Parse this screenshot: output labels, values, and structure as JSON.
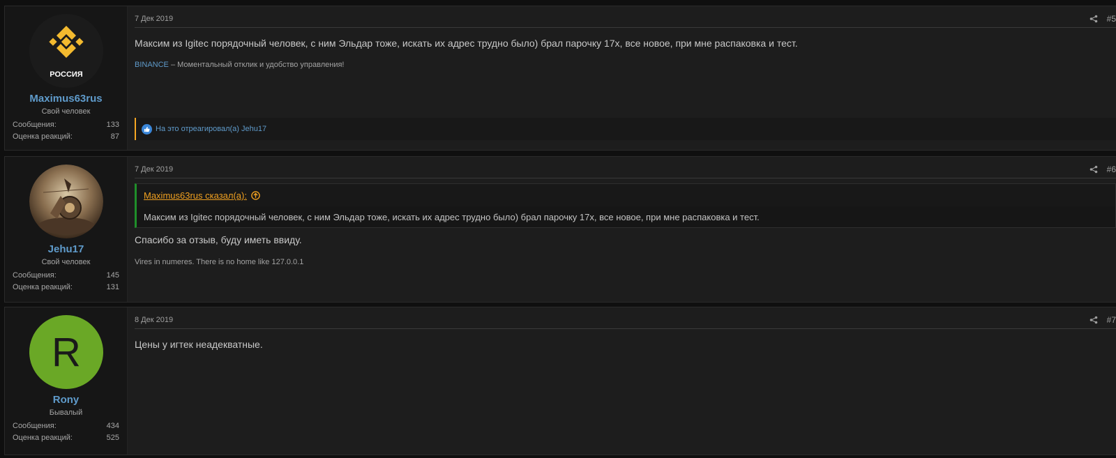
{
  "posts": [
    {
      "username": "Maximus63rus",
      "user_title": "Свой человек",
      "avatar_text": "РОССИЯ",
      "stats": [
        {
          "label": "Сообщения:",
          "value": "133"
        },
        {
          "label": "Оценка реакций:",
          "value": "87"
        }
      ],
      "date": "7 Дек 2019",
      "number": "#5",
      "message": "Максим из Igitec порядочный человек, с ним Эльдар тоже, искать их адрес трудно было) брал парочку 17х, все новое, при мне распаковка и тест.",
      "signature_link": "BINANCE",
      "signature_text": " – Моментальный отклик и удобство управления!",
      "reactions": "На это отреагировал(а) Jehu17"
    },
    {
      "username": "Jehu17",
      "user_title": "Свой человек",
      "stats": [
        {
          "label": "Сообщения:",
          "value": "145"
        },
        {
          "label": "Оценка реакций:",
          "value": "131"
        }
      ],
      "date": "7 Дек 2019",
      "number": "#6",
      "quote_author": "Maximus63rus сказал(а):",
      "quote_text": "Максим из Igitec порядочный человек, с ним Эльдар тоже, искать их адрес трудно было) брал парочку 17х, все новое, при мне распаковка и тест.",
      "message": "Спасибо за отзыв, буду иметь ввиду.",
      "signature_text": "Vires in numeres. There is no home like 127.0.0.1"
    },
    {
      "username": "Rony",
      "user_title": "Бывалый",
      "avatar_letter": "R",
      "stats": [
        {
          "label": "Сообщения:",
          "value": "434"
        },
        {
          "label": "Оценка реакций:",
          "value": "525"
        }
      ],
      "date": "8 Дек 2019",
      "number": "#7",
      "message": "Цены у игтек неадекватные."
    }
  ],
  "colors": {
    "username": "#5f9bcb",
    "quote_link": "#f0a020",
    "quote_border": "#1f8f2a",
    "reaction_border": "#f5a623",
    "binance_yellow": "#f3ba2f",
    "rony_avatar": "#6aa826"
  },
  "icons": [
    "share-icon",
    "like-icon",
    "quote-arrow-up-icon",
    "binance-logo"
  ]
}
